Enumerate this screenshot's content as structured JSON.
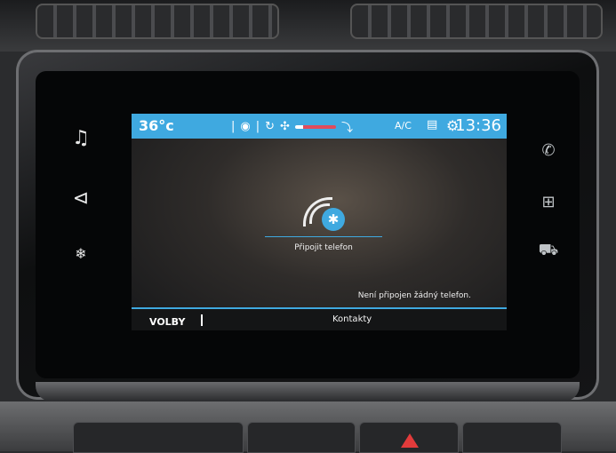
{
  "status_bar": {
    "temperature": "36°c",
    "ac_label": "A/C",
    "clock": "13:36"
  },
  "main": {
    "connect_label": "Připojit telefon",
    "status_message": "Není připojen žádný telefon."
  },
  "bottom_bar": {
    "options_label": "VOLBY",
    "contacts_label": "Kontakty"
  },
  "side_keys_left": [
    "music-icon",
    "navigation-icon",
    "climate-icon"
  ],
  "side_keys_right": [
    "phone-icon",
    "apps-grid-icon",
    "car-icon"
  ],
  "colors": {
    "accent": "#3fa9e0",
    "fan_level": "#e04c5d"
  }
}
